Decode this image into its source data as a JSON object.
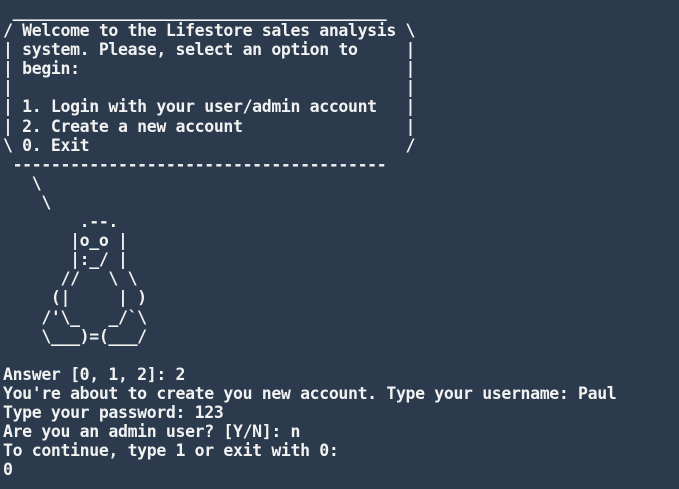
{
  "terminal": {
    "lines": [
      " _______________________________________",
      "/ Welcome to the Lifestore sales analysis \\",
      "| system. Please, select an option to     |",
      "| begin:                                  |",
      "|                                         |",
      "| 1. Login with your user/admin account   |",
      "| 2. Create a new account                 |",
      "\\ 0. Exit                                 /",
      " ---------------------------------------",
      "   \\",
      "    \\",
      "        .--.",
      "       |o_o |",
      "       |:_/ |",
      "      //   \\ \\",
      "     (|     | )",
      "    /'\\_   _/`\\",
      "    \\___)=(___/",
      "",
      "Answer [0, 1, 2]: 2",
      "You're about to create you new account. Type your username: Paul",
      "Type your password: 123",
      "Are you an admin user? [Y/N]: n",
      "To continue, type 1 or exit with 0:",
      "0"
    ]
  }
}
